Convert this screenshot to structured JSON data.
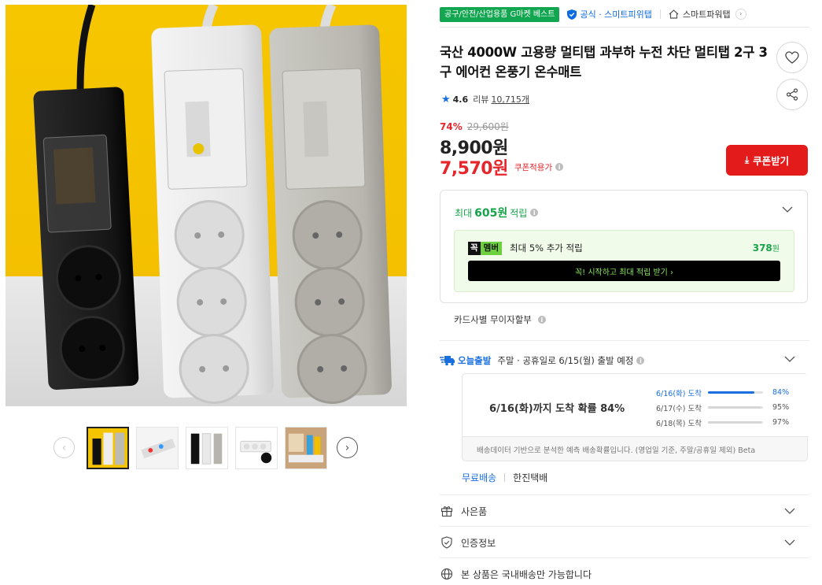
{
  "gallery": {
    "prev_symbol": "‹",
    "next_symbol": "›",
    "thumbnails": [
      "thumb-1",
      "thumb-2",
      "thumb-3",
      "thumb-4",
      "thumb-5"
    ]
  },
  "badges": {
    "best": "공구/안전/산업용품 G마켓 베스트",
    "official": "공식 · 스미트피위탭",
    "store": "스마트파워탭",
    "store_arrow": "›"
  },
  "product": {
    "title": "국산 4000W 고용량 멀티탭 과부하 누전 차단 멀티탭 2구 3구 에어컨 온풍기 온수매트",
    "rating": "4.6",
    "review_label": "리뷰",
    "review_count": "10,715개",
    "discount_rate": "74%",
    "original_price": "29,600원",
    "price": "8,900원",
    "coupon_price": "7,570원",
    "coupon_note": "쿠폰적용가",
    "coupon_button": "쿠폰받기"
  },
  "points": {
    "prefix": "최대",
    "amount": "605원",
    "suffix": "적립",
    "member_logo_k": "꼭",
    "member_logo_m": "멤버",
    "member_text": "최대 5% 추가 적립",
    "member_amount": "378",
    "member_unit": "원",
    "member_cta": "꼭! 시작하고 최대 적립 받기  ›"
  },
  "card": {
    "label": "카드사별 무이자할부"
  },
  "delivery": {
    "today_label": "오늘출발",
    "message": "주말 · 공휴일로 6/15(월) 출발 예정",
    "headline": "6/16(화)까지 도착 확률 84%",
    "probabilities": [
      {
        "date": "6/16(화) 도착",
        "percent": 84,
        "label": "84%"
      },
      {
        "date": "6/17(수) 도착",
        "percent": 95,
        "label": "95%"
      },
      {
        "date": "6/18(목) 도착",
        "percent": 97,
        "label": "97%"
      }
    ],
    "note": "배송데이터 기반으로 분석한 예측 배송확률입니다. (영업일 기준, 주말/공휴일 제외)  Beta",
    "free_shipping": "무료배송",
    "courier": "한진택배"
  },
  "sections": {
    "gift": "사은품",
    "certification": "인증정보",
    "domestic": "본 상품은 국내배송만 가능합니다"
  },
  "colors": {
    "accent_blue": "#1a6fe0",
    "sale_red": "#e5262c",
    "green": "#16a34a",
    "best_badge": "#12a650"
  }
}
